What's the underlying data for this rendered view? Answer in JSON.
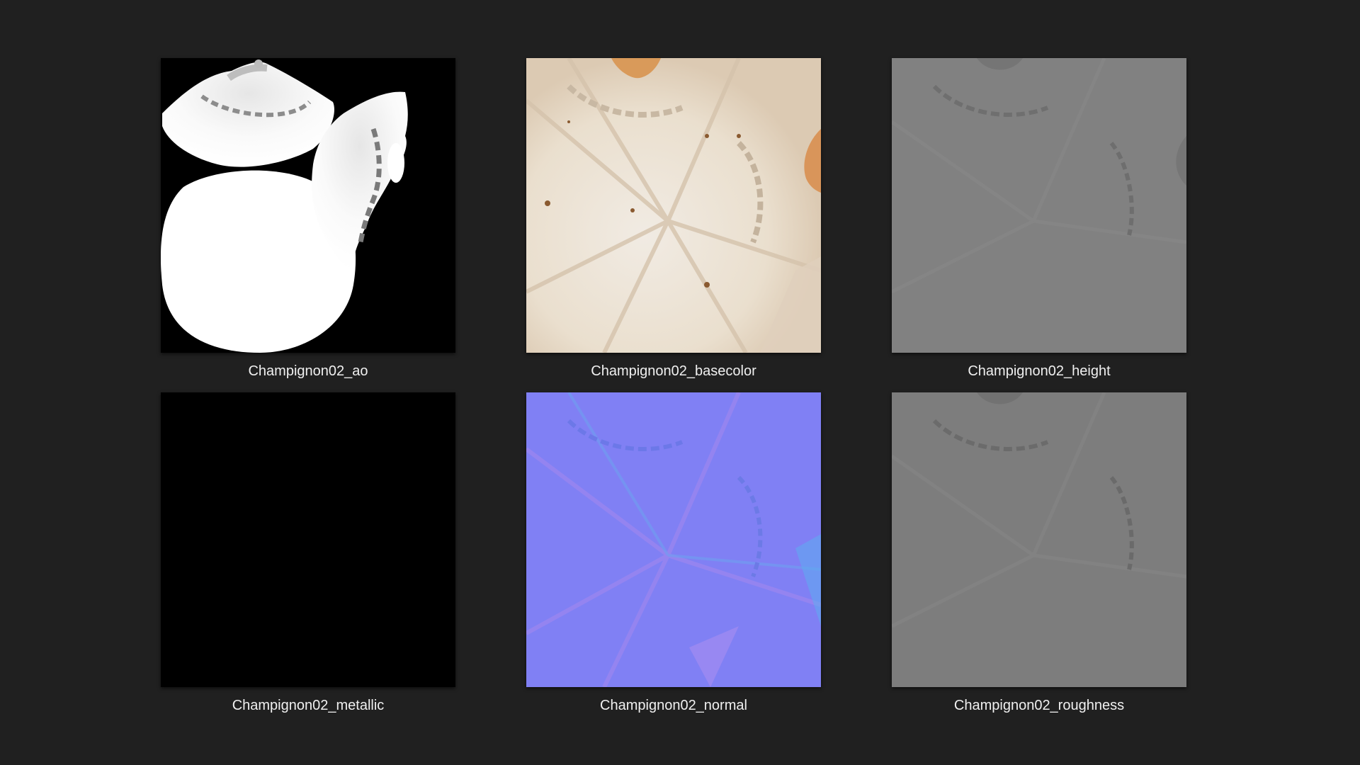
{
  "files": [
    {
      "name": "Champignon02_ao",
      "map": "ambient-occlusion"
    },
    {
      "name": "Champignon02_basecolor",
      "map": "base-color"
    },
    {
      "name": "Champignon02_height",
      "map": "height"
    },
    {
      "name": "Champignon02_metallic",
      "map": "metallic"
    },
    {
      "name": "Champignon02_normal",
      "map": "normal"
    },
    {
      "name": "Champignon02_roughness",
      "map": "roughness"
    }
  ],
  "colors": {
    "background": "#202020",
    "label_text": "#f0f0f0",
    "normal_base": "#7f7fff",
    "height_base": "#808080",
    "roughness_base": "#7d7d7d",
    "basecolor_base": "#ece3d6",
    "metallic_base": "#000000"
  }
}
